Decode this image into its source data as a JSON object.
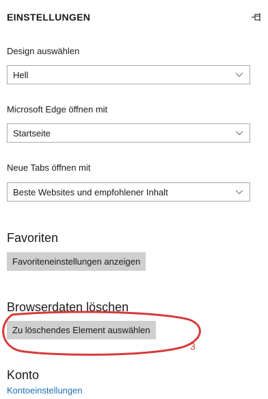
{
  "header": {
    "title": "EINSTELLUNGEN",
    "pin_icon": "pin-icon"
  },
  "design": {
    "label": "Design auswählen",
    "value": "Hell"
  },
  "edge_open": {
    "label": "Microsoft Edge öffnen mit",
    "value": "Startseite"
  },
  "new_tabs": {
    "label": "Neue Tabs öffnen mit",
    "value": "Beste Websites und empfohlener Inhalt"
  },
  "favorites": {
    "title": "Favoriten",
    "button_label": "Favoriteneinstellungen anzeigen"
  },
  "browser_data": {
    "title": "Browserdaten löschen",
    "button_label": "Zu löschendes Element auswählen"
  },
  "account": {
    "title": "Konto",
    "link_label": "Kontoeinstellungen"
  },
  "annotation": {
    "number": "3",
    "color": "#d63a3a"
  },
  "colors": {
    "button_bg": "#cfcfcf",
    "link": "#1b6fb5",
    "border": "#a8a8a8"
  }
}
